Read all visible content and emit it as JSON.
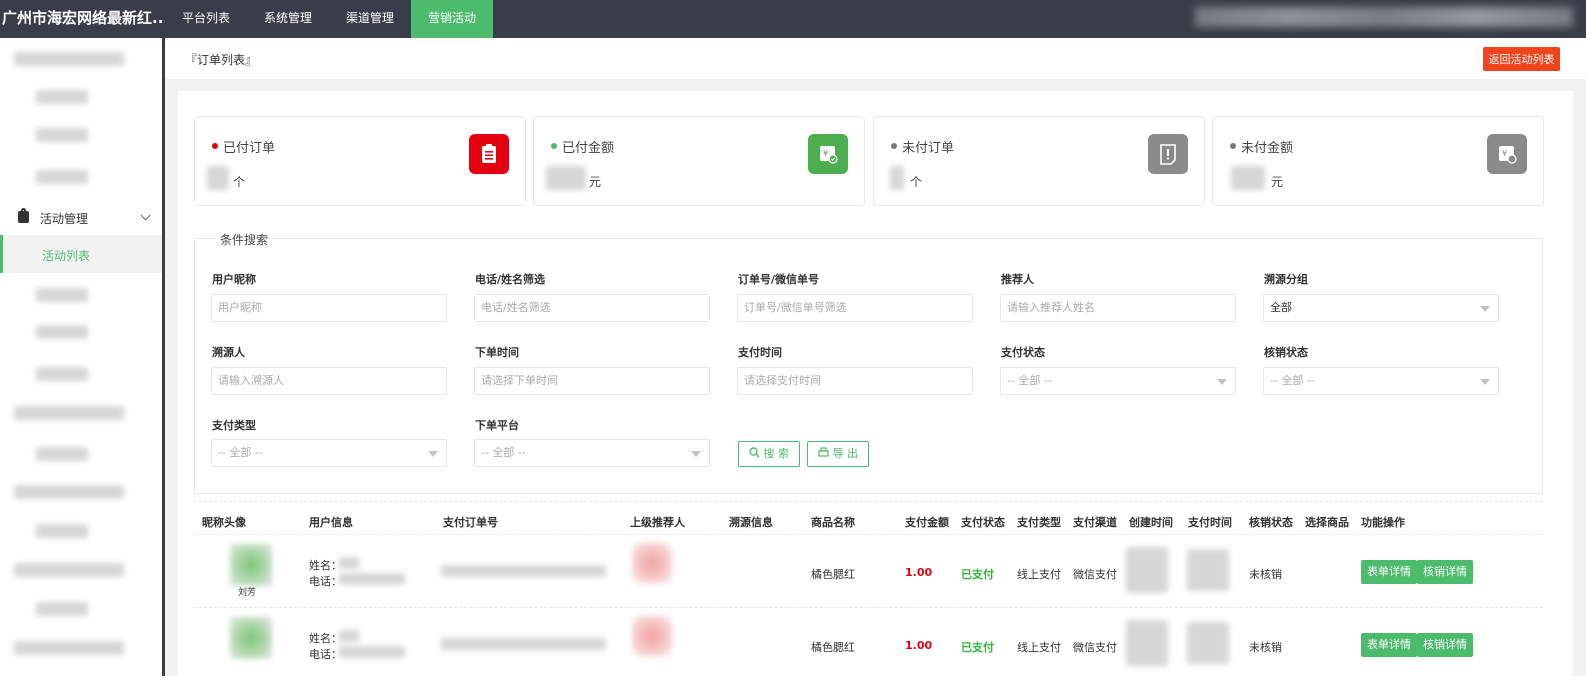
{
  "app": {
    "title": "广州市海宏网络最新红..."
  },
  "topnav": [
    "平台列表",
    "系统管理",
    "渠道管理",
    "营销活动"
  ],
  "sidebar": {
    "parent": "活动管理",
    "active": "活动列表"
  },
  "header": {
    "title": "『订单列表』",
    "back_button": "返回活动列表"
  },
  "stats": [
    {
      "label": "已付订单",
      "unit": "个",
      "color": "#e4000f",
      "dot": "#e4000f",
      "icon": "clipboard-icon"
    },
    {
      "label": "已付金额",
      "unit": "元",
      "color": "#4cae4f",
      "dot": "#4cbb6c",
      "icon": "money-check-icon"
    },
    {
      "label": "未付订单",
      "unit": "个",
      "color": "#8a8a8a",
      "dot": "#777777",
      "icon": "alert-doc-icon"
    },
    {
      "label": "未付金额",
      "unit": "元",
      "color": "#8a8a8a",
      "dot": "#777777",
      "icon": "money-clock-icon"
    }
  ],
  "search": {
    "legend": "条件搜索",
    "fields": [
      {
        "label": "用户昵称",
        "placeholder": "用户昵称"
      },
      {
        "label": "电话/姓名筛选",
        "placeholder": "电话/姓名筛选"
      },
      {
        "label": "订单号/微信单号",
        "placeholder": "订单号/微信单号筛选"
      },
      {
        "label": "推荐人",
        "placeholder": "请输入推荐人姓名"
      },
      {
        "label": "溯源分组",
        "value": "全部"
      },
      {
        "label": "溯源人",
        "placeholder": "请输入溯源人"
      },
      {
        "label": "下单时间",
        "placeholder": "请选择下单时间"
      },
      {
        "label": "支付时间",
        "placeholder": "请选择支付时间"
      },
      {
        "label": "支付状态",
        "value": "-- 全部 --"
      },
      {
        "label": "核销状态",
        "value": "-- 全部 --"
      },
      {
        "label": "支付类型",
        "value": "-- 全部 --"
      },
      {
        "label": "下单平台",
        "value": "-- 全部 --"
      }
    ],
    "search_button": "搜 索",
    "export_button": "导 出"
  },
  "table": {
    "headers": [
      "昵称头像",
      "用户信息",
      "支付订单号",
      "上级推荐人",
      "溯源信息",
      "商品名称",
      "支付金额",
      "支付状态",
      "支付类型",
      "支付渠道",
      "创建时间",
      "支付时间",
      "核销状态",
      "选择商品",
      "功能操作"
    ],
    "rows": [
      {
        "nickname": "刘芳",
        "name_label": "姓名：",
        "phone_label": "电话：",
        "product": "橘色腮红",
        "amount": "1.00",
        "pay_status": "已支付",
        "pay_type": "线上支付",
        "channel": "微信支付",
        "verify": "未核销",
        "btn_form": "表单详情",
        "btn_verify": "核销详情"
      },
      {
        "nickname": "",
        "name_label": "姓名：",
        "phone_label": "电话：",
        "product": "橘色腮红",
        "amount": "1.00",
        "pay_status": "已支付",
        "pay_type": "线上支付",
        "channel": "微信支付",
        "verify": "未核销",
        "btn_form": "表单详情",
        "btn_verify": "核销详情"
      }
    ]
  }
}
